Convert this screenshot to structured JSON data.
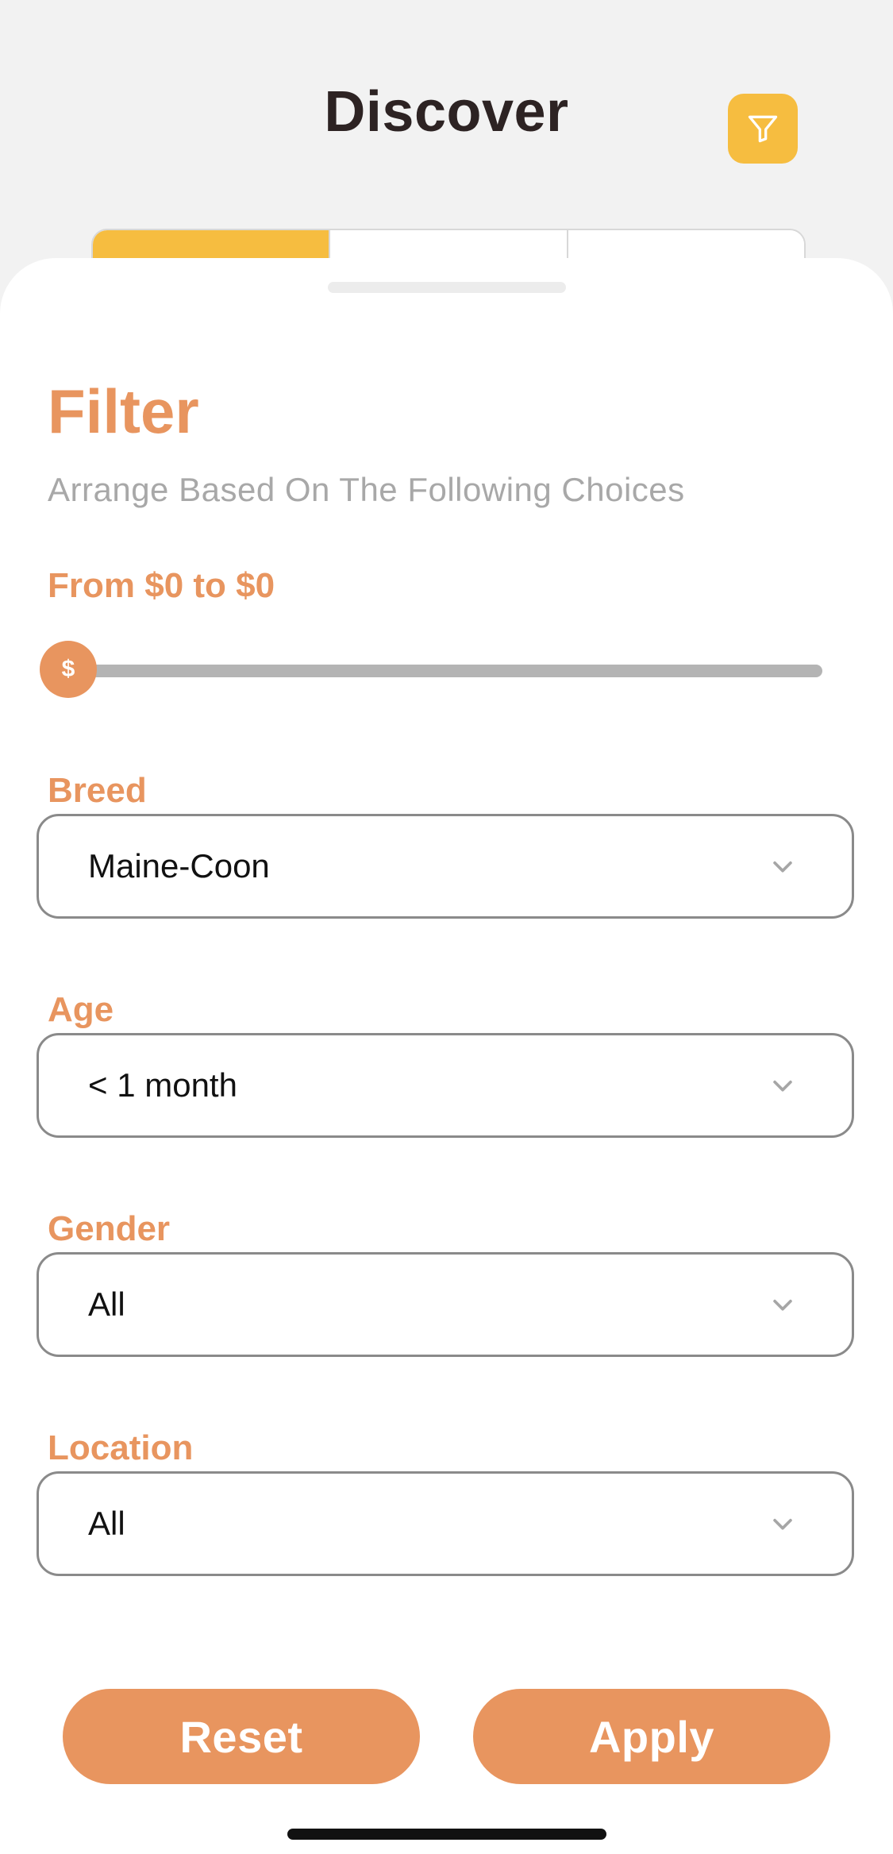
{
  "header": {
    "title": "Discover",
    "filter_icon": "filter-funnel-icon",
    "accent_color": "#f6bd40"
  },
  "tabs": {
    "count": 3,
    "active_index": 0
  },
  "sheet": {
    "title": "Filter",
    "subtitle": "Arrange Based On The Following Choices",
    "price": {
      "label": "From $0 to $0",
      "thumb_symbol": "$",
      "value_fraction": 0
    },
    "fields": [
      {
        "label": "Breed",
        "value": "Maine-Coon"
      },
      {
        "label": "Age",
        "value": "< 1 month"
      },
      {
        "label": "Gender",
        "value": "All"
      },
      {
        "label": "Location",
        "value": "All"
      }
    ],
    "buttons": {
      "reset": "Reset",
      "apply": "Apply"
    },
    "accent_color": "#e8955f"
  }
}
